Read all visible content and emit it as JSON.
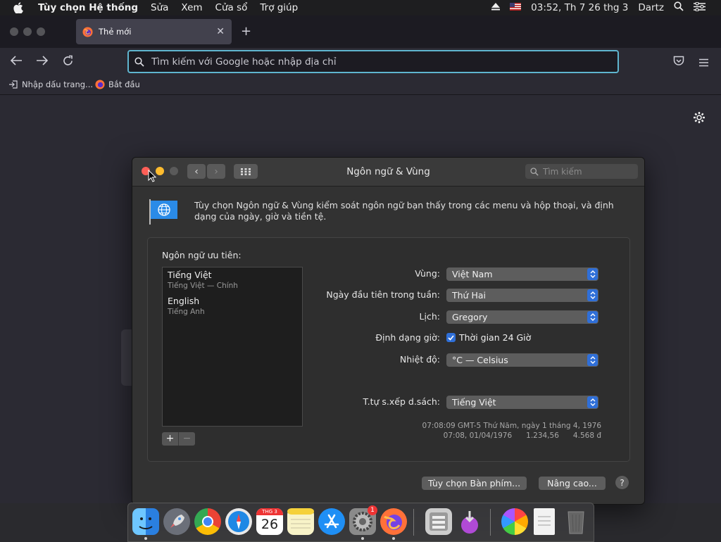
{
  "menubar": {
    "app_name": "Tùy chọn Hệ thống",
    "items": [
      "Sửa",
      "Xem",
      "Cửa sổ",
      "Trợ giúp"
    ],
    "clock": "03:52, Th 7 26 thg 3",
    "user": "Dartz"
  },
  "browser": {
    "tab_title": "Thẻ mới",
    "url_placeholder": "Tìm kiếm với Google hoặc nhập địa chỉ",
    "bookmarks": [
      "Nhập dấu trang...",
      "Bắt đầu"
    ]
  },
  "prefs_window": {
    "title": "Ngôn ngữ & Vùng",
    "search_placeholder": "Tìm kiếm",
    "description": "Tùy chọn Ngôn ngữ & Vùng kiểm soát ngôn ngữ bạn thấy trong các menu và hộp thoại, và định dạng của ngày, giờ và tiền tệ.",
    "preferred_languages_label": "Ngôn ngữ ưu tiên:",
    "languages": [
      {
        "name": "Tiếng Việt",
        "sub": "Tiếng Việt — Chính"
      },
      {
        "name": "English",
        "sub": "Tiếng Anh"
      }
    ],
    "region_label": "Vùng:",
    "region_value": "Việt Nam",
    "first_day_label": "Ngày đầu tiên trong tuần:",
    "first_day_value": "Thứ Hai",
    "calendar_label": "Lịch:",
    "calendar_value": "Gregory",
    "time_format_label": "Định dạng giờ:",
    "time_format_option": "Thời gian 24 Giờ",
    "time_format_checked": true,
    "temperature_label": "Nhiệt độ:",
    "temperature_value": "°C — Celsius",
    "list_sort_label": "T.tự s.xếp d.sách:",
    "list_sort_value": "Tiếng Việt",
    "sample_line1": "07:08:09 GMT-5 Thứ Năm, ngày 1 tháng 4, 1976",
    "sample_line2": "07:08, 01/04/1976      1.234,56      4.568 đ",
    "keyboard_button": "Tùy chọn Bàn phím...",
    "advanced_button": "Nâng cao...",
    "help_button": "?"
  },
  "dock": {
    "calendar_month": "THG 3",
    "calendar_day": "26",
    "sysprefs_badge": "1",
    "apps": [
      "finder",
      "launchpad",
      "chrome",
      "safari",
      "calendar",
      "notes",
      "app-store",
      "system-preferences",
      "firefox",
      "archive-utility",
      "downloads",
      "photos",
      "document",
      "trash"
    ]
  },
  "colors": {
    "accent_blue": "#2f6fd8",
    "url_focus": "#5fb5cf",
    "close_red": "#ff5f57",
    "minimize_yellow": "#febc2e"
  }
}
